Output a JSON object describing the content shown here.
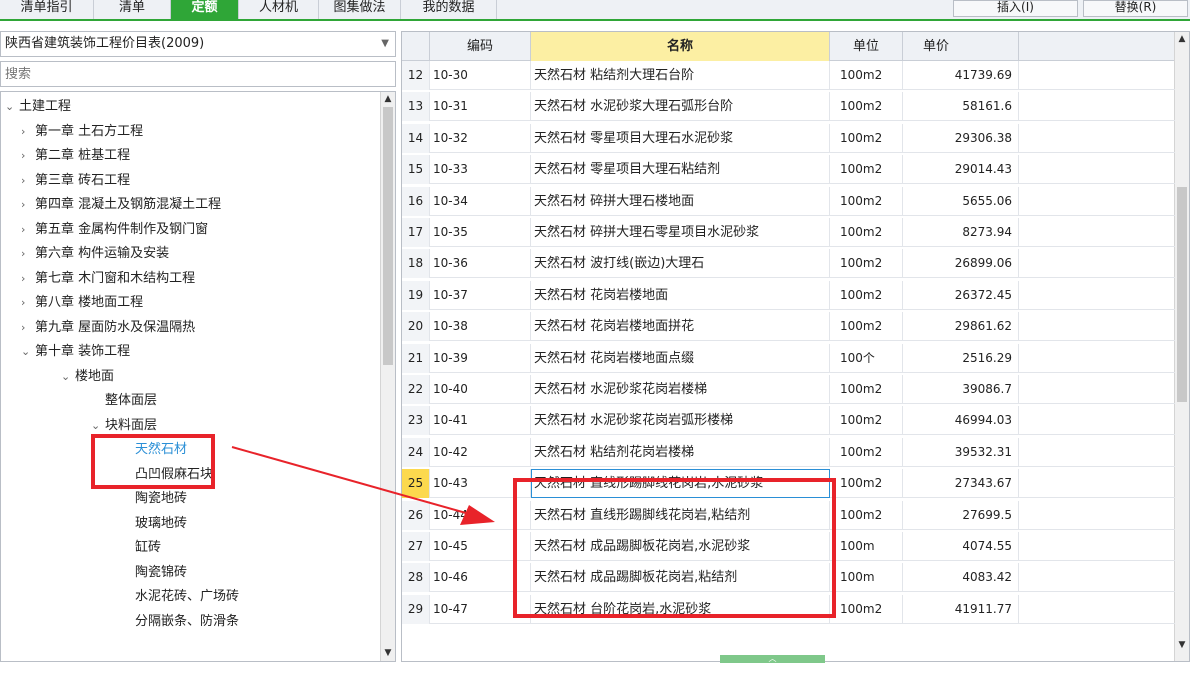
{
  "tabs": [
    {
      "label": "清单指引",
      "active": false
    },
    {
      "label": "清单",
      "active": false
    },
    {
      "label": "定额",
      "active": true
    },
    {
      "label": "人材机",
      "active": false
    },
    {
      "label": "图集做法",
      "active": false
    },
    {
      "label": "我的数据",
      "active": false
    }
  ],
  "toolbar": {
    "insert_label": "插入(I)",
    "replace_label": "替换(R)"
  },
  "library": {
    "selected": "陕西省建筑装饰工程价目表(2009)"
  },
  "search": {
    "placeholder": "搜索"
  },
  "tree": [
    {
      "label": "土建工程",
      "toggle": "✓",
      "level": 0
    },
    {
      "label": "第一章 土石方工程",
      "toggle": "›",
      "level": 1
    },
    {
      "label": "第二章 桩基工程",
      "toggle": "›",
      "level": 1
    },
    {
      "label": "第三章 砖石工程",
      "toggle": "›",
      "level": 1
    },
    {
      "label": "第四章 混凝土及钢筋混凝土工程",
      "toggle": "›",
      "level": 1
    },
    {
      "label": "第五章 金属构件制作及钢门窗",
      "toggle": "›",
      "level": 1
    },
    {
      "label": "第六章 构件运输及安装",
      "toggle": "›",
      "level": 1
    },
    {
      "label": "第七章 木门窗和木结构工程",
      "toggle": "›",
      "level": 1
    },
    {
      "label": "第八章 楼地面工程",
      "toggle": "›",
      "level": 1
    },
    {
      "label": "第九章 屋面防水及保温隔热",
      "toggle": "›",
      "level": 1
    },
    {
      "label": "第十章 装饰工程",
      "toggle": "✓",
      "level": 1
    },
    {
      "label": "楼地面",
      "toggle": "✓",
      "level": 2
    },
    {
      "label": "整体面层",
      "toggle": "",
      "level": 3
    },
    {
      "label": "块料面层",
      "toggle": "✓",
      "level": 3
    },
    {
      "label": "天然石材",
      "toggle": "",
      "level": 4,
      "selected": true
    },
    {
      "label": "凸凹假麻石块",
      "toggle": "",
      "level": 4
    },
    {
      "label": "陶瓷地砖",
      "toggle": "",
      "level": 4
    },
    {
      "label": "玻璃地砖",
      "toggle": "",
      "level": 4
    },
    {
      "label": "缸砖",
      "toggle": "",
      "level": 4
    },
    {
      "label": "陶瓷锦砖",
      "toggle": "",
      "level": 4
    },
    {
      "label": "水泥花砖、广场砖",
      "toggle": "",
      "level": 4
    },
    {
      "label": "分隔嵌条、防滑条",
      "toggle": "",
      "level": 4
    }
  ],
  "grid": {
    "headers": {
      "code": "编码",
      "name": "名称",
      "unit": "单位",
      "price": "单价"
    },
    "rows": [
      {
        "num": "12",
        "code": "10-30",
        "name": "天然石材 粘结剂大理石台阶",
        "unit": "100m2",
        "price": "41739.69"
      },
      {
        "num": "13",
        "code": "10-31",
        "name": "天然石材 水泥砂浆大理石弧形台阶",
        "unit": "100m2",
        "price": "58161.6"
      },
      {
        "num": "14",
        "code": "10-32",
        "name": "天然石材 零星项目大理石水泥砂浆",
        "unit": "100m2",
        "price": "29306.38"
      },
      {
        "num": "15",
        "code": "10-33",
        "name": "天然石材 零星项目大理石粘结剂",
        "unit": "100m2",
        "price": "29014.43"
      },
      {
        "num": "16",
        "code": "10-34",
        "name": "天然石材 碎拼大理石楼地面",
        "unit": "100m2",
        "price": "5655.06"
      },
      {
        "num": "17",
        "code": "10-35",
        "name": "天然石材 碎拼大理石零星项目水泥砂浆",
        "unit": "100m2",
        "price": "8273.94"
      },
      {
        "num": "18",
        "code": "10-36",
        "name": "天然石材 波打线(嵌边)大理石",
        "unit": "100m2",
        "price": "26899.06"
      },
      {
        "num": "19",
        "code": "10-37",
        "name": "天然石材 花岗岩楼地面",
        "unit": "100m2",
        "price": "26372.45"
      },
      {
        "num": "20",
        "code": "10-38",
        "name": "天然石材 花岗岩楼地面拼花",
        "unit": "100m2",
        "price": "29861.62"
      },
      {
        "num": "21",
        "code": "10-39",
        "name": "天然石材 花岗岩楼地面点缀",
        "unit": "100个",
        "price": "2516.29"
      },
      {
        "num": "22",
        "code": "10-40",
        "name": "天然石材 水泥砂浆花岗岩楼梯",
        "unit": "100m2",
        "price": "39086.7"
      },
      {
        "num": "23",
        "code": "10-41",
        "name": "天然石材 水泥砂浆花岗岩弧形楼梯",
        "unit": "100m2",
        "price": "46994.03"
      },
      {
        "num": "24",
        "code": "10-42",
        "name": "天然石材 粘结剂花岗岩楼梯",
        "unit": "100m2",
        "price": "39532.31"
      },
      {
        "num": "25",
        "code": "10-43",
        "name": "天然石材 直线形踢脚线花岗岩,水泥砂浆",
        "unit": "100m2",
        "price": "27343.67",
        "current": true
      },
      {
        "num": "26",
        "code": "10-44",
        "name": "天然石材 直线形踢脚线花岗岩,粘结剂",
        "unit": "100m2",
        "price": "27699.5"
      },
      {
        "num": "27",
        "code": "10-45",
        "name": "天然石材 成品踢脚板花岗岩,水泥砂浆",
        "unit": "100m",
        "price": "4074.55"
      },
      {
        "num": "28",
        "code": "10-46",
        "name": "天然石材 成品踢脚板花岗岩,粘结剂",
        "unit": "100m",
        "price": "4083.42"
      },
      {
        "num": "29",
        "code": "10-47",
        "name": "天然石材 台阶花岗岩,水泥砂浆",
        "unit": "100m2",
        "price": "41911.77"
      }
    ]
  },
  "colors": {
    "accent": "#2fa637",
    "selected_text": "#2a8fd6",
    "annotation": "#e8232a",
    "name_header": "#fcefa3",
    "current_row_marker": "#fcd94e"
  }
}
